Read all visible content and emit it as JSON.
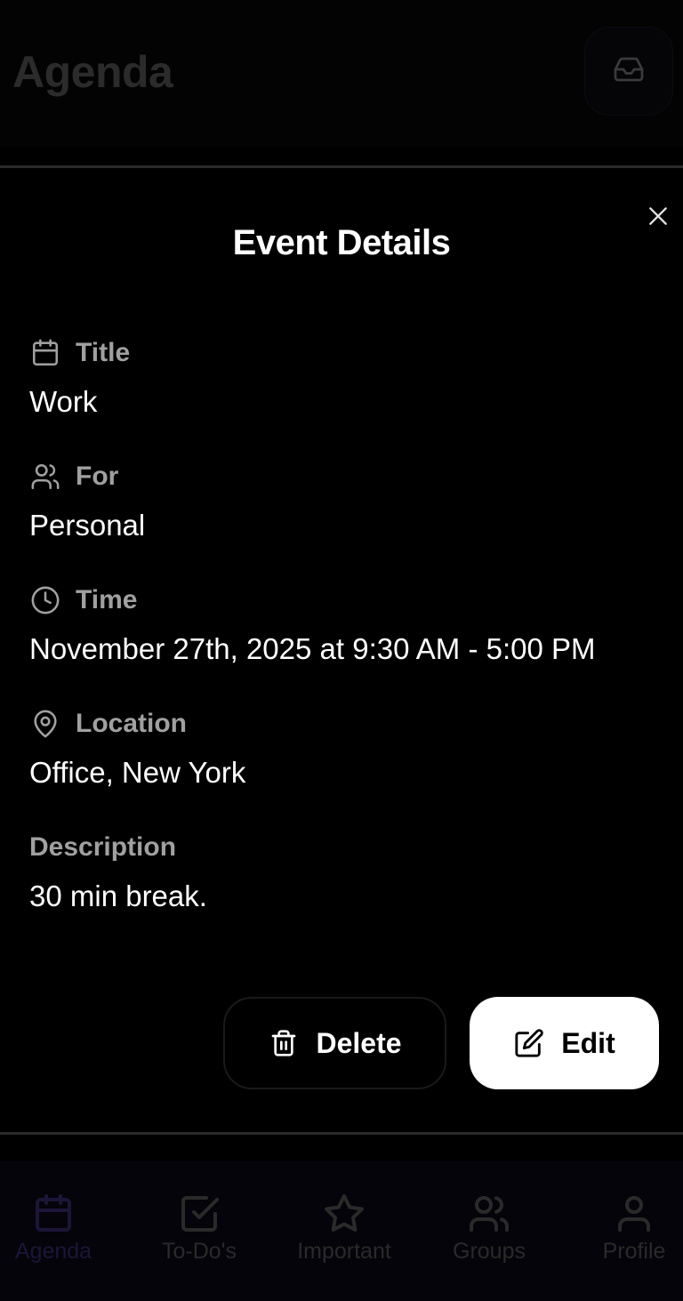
{
  "header": {
    "title": "Agenda",
    "inbox_icon": "inbox-icon"
  },
  "modal": {
    "title": "Event Details",
    "close_icon": "close-icon",
    "fields": {
      "title": {
        "label": "Title",
        "value": "Work",
        "icon": "calendar-icon"
      },
      "for": {
        "label": "For",
        "value": "Personal",
        "icon": "users-icon"
      },
      "time": {
        "label": "Time",
        "value": "November 27th, 2025 at 9:30 AM - 5:00 PM",
        "icon": "clock-icon"
      },
      "location": {
        "label": "Location",
        "value": "Office, New York",
        "icon": "map-pin-icon"
      },
      "description": {
        "label": "Description",
        "value": "30 min break."
      }
    },
    "actions": {
      "delete_label": "Delete",
      "delete_icon": "trash-icon",
      "edit_label": "Edit",
      "edit_icon": "edit-icon"
    }
  },
  "tabbar": {
    "tabs": [
      {
        "label": "Agenda",
        "icon": "calendar-icon",
        "active": true
      },
      {
        "label": "To-Do's",
        "icon": "checkbox-icon",
        "active": false
      },
      {
        "label": "Important",
        "icon": "star-icon",
        "active": false
      },
      {
        "label": "Groups",
        "icon": "users-icon",
        "active": false
      },
      {
        "label": "Profile",
        "icon": "user-icon",
        "active": false
      }
    ]
  },
  "colors": {
    "background": "#000000",
    "active_tab": "#1d1538",
    "edit_button_bg": "#ffffff",
    "label_gray": "#a0a0a0"
  }
}
